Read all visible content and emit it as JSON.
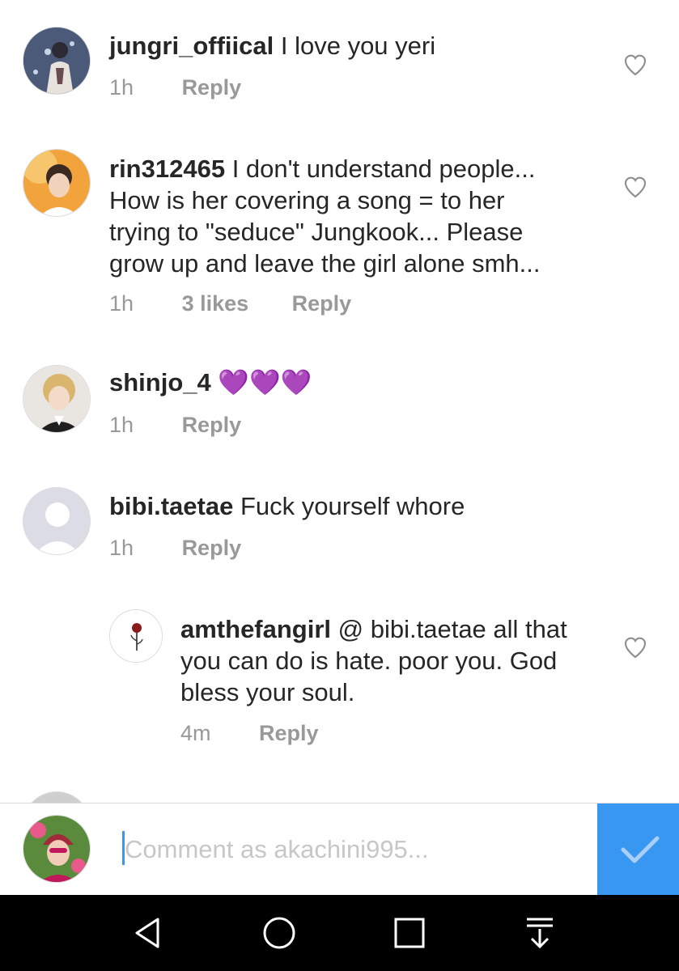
{
  "comments": [
    {
      "username": "jungri_offiical",
      "text": " I love you yeri",
      "time": "1h",
      "reply": "Reply"
    },
    {
      "username": "rin312465",
      "text_lines": [
        "I don't understand people...",
        "How is her covering a song = to her",
        "trying to \"seduce\" Jungkook... Please",
        "grow up and leave the girl alone smh..."
      ],
      "time": "1h",
      "likes": "3 likes",
      "reply": "Reply"
    },
    {
      "username": "shinjo_4",
      "text": " 💜💜💜",
      "time": "1h",
      "reply": "Reply"
    },
    {
      "username": "bibi.taetae",
      "text": " Fuck yourself whore",
      "time": "1h",
      "reply": "Reply"
    },
    {
      "username": "amthefangirl",
      "text_lines": [
        "@ bibi.taetae all that",
        "you can do is hate. poor you. God",
        "bless your soul."
      ],
      "time": "4m",
      "reply": "Reply"
    }
  ],
  "composer": {
    "placeholder": "Comment as akachini995..."
  },
  "icons": {
    "like": "heart-outline-icon",
    "send": "checkmark-icon",
    "nav": [
      "back-icon",
      "home-icon",
      "recents-icon",
      "notification-drawer-icon"
    ]
  },
  "colors": {
    "accent": "#3897f0",
    "muted": "#999999",
    "heart_emoji": "#8a2be2"
  }
}
